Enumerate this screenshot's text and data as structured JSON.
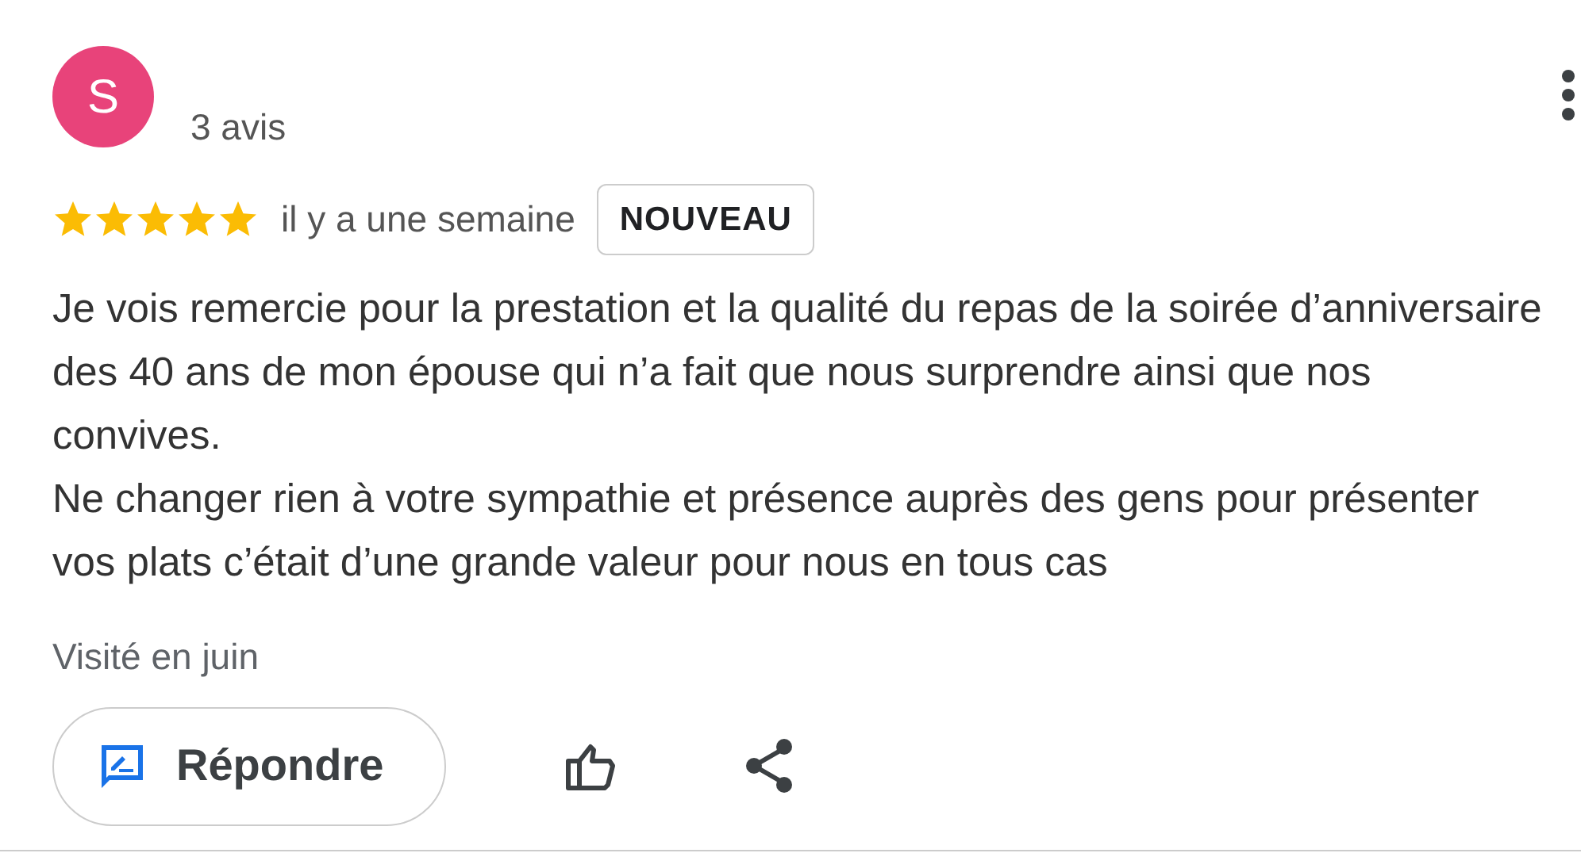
{
  "reviewer": {
    "initial": "S",
    "color": "#e8437a",
    "review_count": "3 avis"
  },
  "rating": {
    "stars": 5,
    "time": "il y a une semaine",
    "badge": "NOUVEAU"
  },
  "body": [
    "Je vois remercie pour la prestation et la qualité du repas de la soirée d’anniversaire des 40 ans de mon épouse qui n’a fait que nous surprendre ainsi que nos convives.",
    "Ne changer rien à votre sympathie et présence auprès des gens pour présenter vos plats c’était d’une grande valeur pour nous en tous cas"
  ],
  "visited": "Visité en juin",
  "reply_button": "Répondre"
}
